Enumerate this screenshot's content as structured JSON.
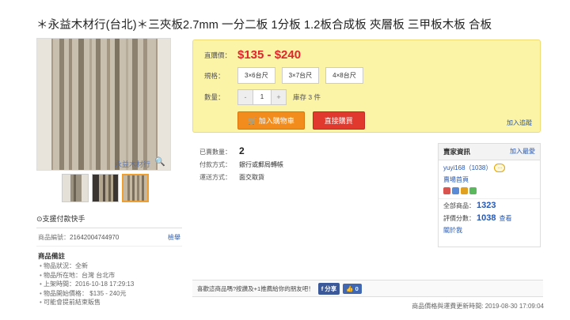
{
  "title": "＊永益木材行(台北)＊三夾板2.7mm 一分二板 1分板 1.2板合成板 夾層板 三甲板木板 合板",
  "gallery": {
    "watermark": "永益木材行",
    "zoom_icon": "magnifier-icon",
    "thumb_count": 3,
    "active_thumb": 3
  },
  "payment_hand": "⊙支援付款快手",
  "product": {
    "id_label": "商品編號：",
    "id_value": "21642004744970",
    "report_link": "檢舉",
    "notes_title": "商品備註",
    "notes": [
      "物品狀況：全新",
      "物品所在地：台灣 台北市",
      "上架時間：2016-10-18 17:29:13",
      "物品開始價格：  $135 - 240元",
      "可能會提前結束販售"
    ]
  },
  "purchase": {
    "price_label": "直購價：",
    "price": "$135 - $240",
    "spec_label": "規格：",
    "specs": [
      "3×6台尺",
      "3×7台尺",
      "4×8台尺"
    ],
    "qty_label": "數量：",
    "qty_minus": "-",
    "qty_value": "1",
    "qty_plus": "+",
    "stock": "庫存 3 件",
    "cart_button": "加入購物車",
    "buy_button": "直接購買",
    "track_link": "加入追蹤"
  },
  "meta": {
    "sold_label": "已賣數量：",
    "sold_value": "2",
    "pay_label": "付款方式：",
    "pay_value": "銀行或郵局轉帳",
    "ship_label": "運送方式：",
    "ship_value": "面交取貨"
  },
  "seller": {
    "header": "賣家資訊",
    "follow": "加入最愛",
    "user": "yuyi168（1038）",
    "store_link": "賣場首頁",
    "total_label": "全部商品：",
    "total_value": "1323",
    "rating_label": "評價分數：",
    "rating_value": "1038",
    "rating_more": "查看",
    "about": "關於我"
  },
  "share": {
    "text": "喜歡這商品嗎?按讚及+1推薦給你的朋友吧！",
    "share_button": "分享",
    "like_count": "0"
  },
  "updated": "商品價格與運費更新時間: 2019-08-30 17:09:04",
  "colors": {
    "price_red": "#e0252d",
    "price_box_bg": "#fbf3a6",
    "cart_orange": "#f18c1d",
    "buy_red": "#e2392f",
    "link_blue": "#2458b5"
  }
}
